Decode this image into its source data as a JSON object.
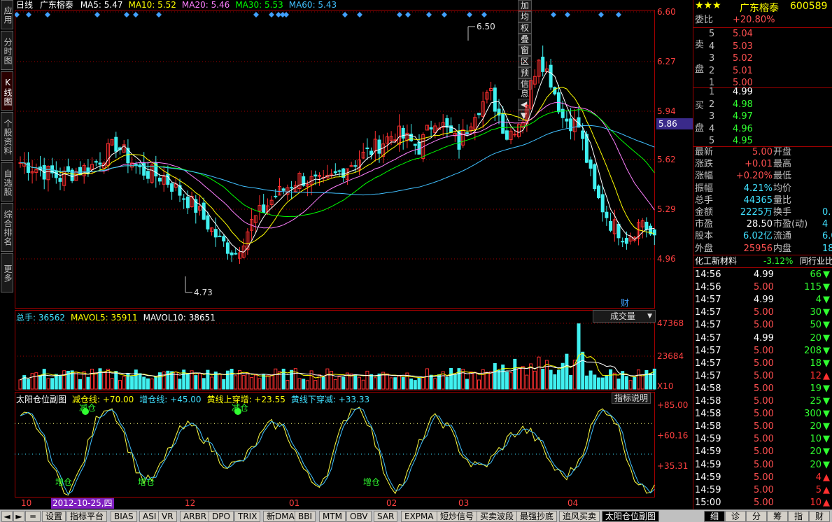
{
  "sidetabs": [
    {
      "label": "应用",
      "active": false
    },
    {
      "label": "分时图",
      "active": false
    },
    {
      "label": "K线图",
      "active": true
    },
    {
      "label": "个股资料",
      "active": false
    },
    {
      "label": "自选股",
      "active": false
    },
    {
      "label": "综合排名",
      "active": false
    },
    {
      "label": "更多",
      "active": false
    }
  ],
  "main": {
    "period": "日线",
    "stock_name": "广东榕泰",
    "ma": [
      {
        "label": "MA5: 5.47",
        "color": "#ffffff"
      },
      {
        "label": "MA10: 5.52",
        "color": "#ffff00"
      },
      {
        "label": "MA20: 5.46",
        "color": "#ff80ff"
      },
      {
        "label": "MA30: 5.53",
        "color": "#00ff00"
      },
      {
        "label": "MA60: 5.43",
        "color": "#40c0ff"
      }
    ],
    "toolbar": [
      "加",
      "均",
      "权",
      "叠",
      "窗",
      "区",
      "预",
      "信息",
      "◀",
      "▼"
    ],
    "yticks": [
      "6.60",
      "6.27",
      "5.94",
      "5.62",
      "5.29",
      "4.96"
    ],
    "current_price_tag": "5.86",
    "high_label": "6.50",
    "low_label": "4.73",
    "fin_marker": "财"
  },
  "volume": {
    "header": [
      {
        "label": "总手: 36562",
        "color": "#40e0ff"
      },
      {
        "label": "MAVOL5: 35911",
        "color": "#ffff00"
      },
      {
        "label": "MAVOL10: 38651",
        "color": "#ffffff"
      }
    ],
    "selector": "成交量",
    "yticks": [
      "47368",
      "23684"
    ],
    "unit": "X10"
  },
  "indicator": {
    "header": [
      {
        "label": "太阳仓位副图",
        "color": "#ffffff"
      },
      {
        "label": "减仓线: +70.00",
        "color": "#ffff00"
      },
      {
        "label": "增仓线: +45.00",
        "color": "#40e0ff"
      },
      {
        "label": "黄线上穿增: +23.55",
        "color": "#ffff00"
      },
      {
        "label": "黄线下穿减: +33.33",
        "color": "#40e0ff"
      }
    ],
    "help_button": "指标说明",
    "yticks": [
      "+85.00",
      "+60.16",
      "+35.31"
    ],
    "sell_label": "减仓",
    "buy_label": "增仓"
  },
  "xaxis": {
    "labels": [
      "10",
      "12",
      "01",
      "02",
      "03",
      "04"
    ],
    "cursor_date": "2012-10-25,四"
  },
  "quote": {
    "stars": "★★★",
    "name": "广东榕泰",
    "code": "600589",
    "webi_label": "委比",
    "webi_value": "+20.80%",
    "sell_label": [
      "卖",
      "盘"
    ],
    "buy_label": [
      "买",
      "盘"
    ],
    "asks": [
      {
        "level": "5",
        "price": "5.04"
      },
      {
        "level": "4",
        "price": "5.03"
      },
      {
        "level": "3",
        "price": "5.02"
      },
      {
        "level": "2",
        "price": "5.01"
      },
      {
        "level": "1",
        "price": "5.00"
      }
    ],
    "bids": [
      {
        "level": "1",
        "price": "4.99"
      },
      {
        "level": "2",
        "price": "4.98"
      },
      {
        "level": "3",
        "price": "4.97"
      },
      {
        "level": "4",
        "price": "4.96"
      },
      {
        "level": "5",
        "price": "4.95"
      }
    ],
    "stats": [
      {
        "l1": "最新",
        "v1": "5.00",
        "c1": "#ff5050",
        "l2": "开盘",
        "v2": ""
      },
      {
        "l1": "涨跌",
        "v1": "+0.01",
        "c1": "#ff5050",
        "l2": "最高",
        "v2": ""
      },
      {
        "l1": "涨幅",
        "v1": "+0.20%",
        "c1": "#ff5050",
        "l2": "最低",
        "v2": ""
      },
      {
        "l1": "振幅",
        "v1": "4.21%",
        "c1": "#40e0ff",
        "l2": "均价",
        "v2": ""
      },
      {
        "l1": "总手",
        "v1": "44365",
        "c1": "#40e0ff",
        "l2": "量比",
        "v2": ""
      },
      {
        "l1": "金额",
        "v1": "2225万",
        "c1": "#40e0ff",
        "l2": "换手",
        "v2": "0."
      },
      {
        "l1": "市盈",
        "v1": "28.50",
        "c1": "#ffffff",
        "l2": "市盈(动)",
        "v2": "4"
      },
      {
        "l1": "股本",
        "v1": "6.02亿",
        "c1": "#40e0ff",
        "l2": "流通",
        "v2": "6.0"
      },
      {
        "l1": "外盘",
        "v1": "25956",
        "c1": "#ff5050",
        "l2": "内盘",
        "v2": "18"
      }
    ],
    "sector": "化工新材料",
    "sector_change": "-3.12%",
    "sector_rank": "同行业比",
    "ticks": [
      {
        "time": "14:56",
        "price": "4.99",
        "pc": "#ffffff",
        "vol": "66",
        "dir": "down"
      },
      {
        "time": "14:56",
        "price": "5.00",
        "pc": "#ff5050",
        "vol": "115",
        "dir": "down"
      },
      {
        "time": "14:57",
        "price": "4.99",
        "pc": "#ffffff",
        "vol": "4",
        "dir": "down"
      },
      {
        "time": "14:57",
        "price": "5.00",
        "pc": "#ff5050",
        "vol": "30",
        "dir": "down"
      },
      {
        "time": "14:57",
        "price": "5.00",
        "pc": "#ff5050",
        "vol": "50",
        "dir": "down"
      },
      {
        "time": "14:57",
        "price": "4.99",
        "pc": "#ffffff",
        "vol": "20",
        "dir": "down"
      },
      {
        "time": "14:57",
        "price": "5.00",
        "pc": "#ff5050",
        "vol": "208",
        "dir": "down"
      },
      {
        "time": "14:57",
        "price": "5.00",
        "pc": "#ff5050",
        "vol": "18",
        "dir": "down"
      },
      {
        "time": "14:57",
        "price": "5.00",
        "pc": "#ff5050",
        "vol": "12",
        "dir": "up"
      },
      {
        "time": "14:58",
        "price": "5.00",
        "pc": "#ff5050",
        "vol": "19",
        "dir": "down"
      },
      {
        "time": "14:58",
        "price": "5.00",
        "pc": "#ff5050",
        "vol": "25",
        "dir": "down"
      },
      {
        "time": "14:58",
        "price": "5.00",
        "pc": "#ff5050",
        "vol": "300",
        "dir": "down"
      },
      {
        "time": "14:58",
        "price": "5.00",
        "pc": "#ff5050",
        "vol": "20",
        "dir": "down"
      },
      {
        "time": "14:59",
        "price": "5.00",
        "pc": "#ff5050",
        "vol": "10",
        "dir": "down"
      },
      {
        "time": "14:59",
        "price": "5.00",
        "pc": "#ff5050",
        "vol": "20",
        "dir": "down"
      },
      {
        "time": "14:59",
        "price": "5.00",
        "pc": "#ff5050",
        "vol": "20",
        "dir": "down"
      },
      {
        "time": "14:59",
        "price": "5.00",
        "pc": "#ff5050",
        "vol": "4",
        "dir": "up"
      },
      {
        "time": "14:59",
        "price": "5.00",
        "pc": "#ff5050",
        "vol": "5",
        "dir": "up"
      },
      {
        "time": "15:00",
        "price": "5.00",
        "pc": "#ff5050",
        "vol": "10",
        "dir": "up"
      }
    ],
    "right_tabs": [
      "细",
      "诊",
      "分",
      "筹",
      "指",
      "财"
    ]
  },
  "bottom_tabs": [
    "设置",
    "指标平台",
    "BIAS",
    "ASI",
    "VR",
    "ARBR",
    "DPO",
    "TRIX",
    "新DMA",
    "BBI",
    "MTM",
    "OBV",
    "SAR",
    "EXPMA",
    "短炒信号",
    "买卖波段",
    "最强抄底",
    "追风买卖",
    "太阳仓位副图"
  ],
  "bottom_active": "太阳仓位副图",
  "colors": {
    "up": "#ff3030",
    "down": "#40f0f0",
    "grid": "#a00000",
    "accent": "#ffff00"
  }
}
